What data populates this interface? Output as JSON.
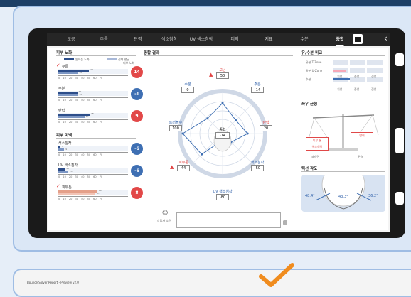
{
  "nav": {
    "tabs": [
      "모공",
      "주름",
      "탄력",
      "색소침착",
      "UV 색소침착",
      "피지",
      "지표",
      "수분",
      "종합"
    ],
    "active_index": 8,
    "back_icon": "chevron-left-icon",
    "home_icon": "home-icon"
  },
  "left": {
    "aging_title": "피부 노화",
    "legend": [
      "원하는 노화",
      "전체 평균"
    ],
    "legend_sub": "피부 노화",
    "items": [
      {
        "label": "주름",
        "value": 14,
        "bar1": 47,
        "bar2": 30,
        "score_color": "red",
        "checked": true,
        "bar1_text": "47",
        "bar2_text": "30"
      },
      {
        "label": "수분",
        "value": -1,
        "bar1": 29,
        "bar2": 30,
        "score_color": "blue",
        "checked": false,
        "bar1_text": "29",
        "bar2_text": "30"
      },
      {
        "label": "탄력",
        "value": 9,
        "bar1": 48,
        "bar2": 40,
        "score_color": "red",
        "checked": false,
        "bar1_text": "48",
        "bar2_text": "40"
      }
    ],
    "beauty_title": "피부 미백",
    "beauty_items": [
      {
        "label": "색소침착",
        "value": -6,
        "bar1": 3,
        "bar2": 9,
        "score_color": "blue",
        "bar1_text": "3",
        "bar2_text": "9"
      },
      {
        "label": "UV 색소침착",
        "value": -6,
        "bar1": 10,
        "bar2": 15,
        "score_color": "blue",
        "bar1_text": "10",
        "bar2_text": "15"
      }
    ],
    "trouble_item": {
      "label": "피부톤",
      "value": 8,
      "bar1": 60,
      "bar2": 57,
      "score_color": "red",
      "bar1_text": "60",
      "bar2_text": "57"
    },
    "axis_ticks": [
      "0",
      "10",
      "20",
      "30",
      "40",
      "50",
      "60",
      "70"
    ]
  },
  "center": {
    "title": "종합 결과",
    "labels": {
      "top": {
        "name": "모공",
        "value": "50",
        "warn": true
      },
      "top_right": {
        "name": "주름",
        "value": "-14"
      },
      "right": {
        "name": "탄력",
        "value": "20"
      },
      "bottom_right": {
        "name": "색소침착",
        "value": "-50"
      },
      "bottom": {
        "name": "UV 색소침착",
        "value": "-80"
      },
      "bottom_left": {
        "name": "피부톤",
        "value": "44",
        "warn": true
      },
      "left": {
        "name": "트러블수",
        "value": "100"
      },
      "top_left": {
        "name": "수분",
        "value": "0"
      }
    },
    "center_label": "종합",
    "center_value": "-14",
    "comment_title": "상담자 소견",
    "comment_icon": "smile-icon",
    "comment_value": ""
  },
  "right": {
    "balance_title": "유/수분 비교",
    "balance_rows": [
      "유분 T-Zone",
      "유분 U-Zone",
      "수분"
    ],
    "balance_cols": [
      "지성",
      "중성",
      "건성"
    ],
    "balance_cols2": [
      "지성",
      "중성",
      "건성"
    ],
    "scale_title": "좌우 균형",
    "scale_left": [
      "피부 톤",
      "색소침착"
    ],
    "scale_right": [
      "탄력"
    ],
    "scale_axis": [
      "좌측면",
      "우측"
    ],
    "angle_title": "턱선 각도",
    "angle_left": "48.4°",
    "angle_center": "43.3°",
    "angle_right": "36.2°"
  },
  "bottom": {
    "window_title": "Bounce Solver Report - Preview v2.0"
  },
  "colors": {
    "red": "#e24848",
    "blue": "#3e6fb3",
    "accent": "#f08c1e"
  }
}
